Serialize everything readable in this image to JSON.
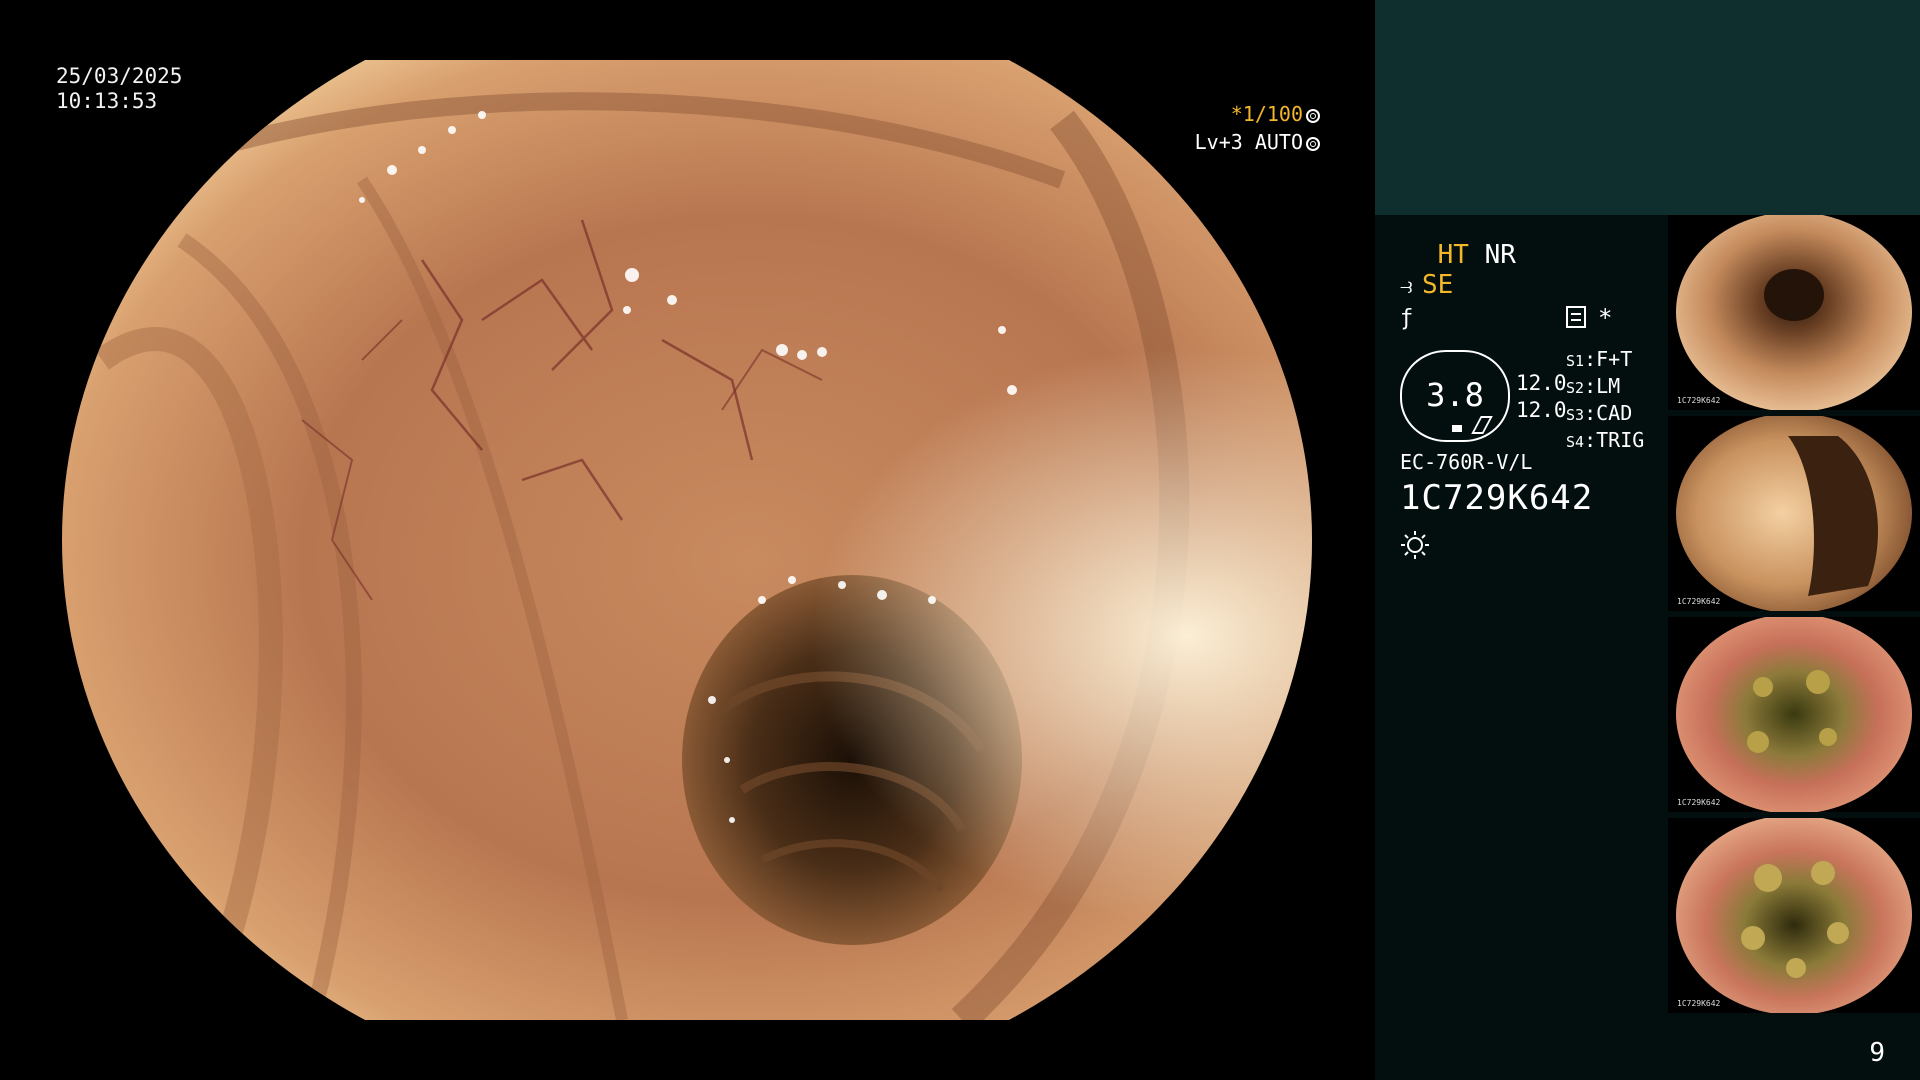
{
  "overlay": {
    "date": "25/03/2025",
    "time": "10:13:53",
    "shutter": "*1/100",
    "level_auto": "Lv+3 AUTO"
  },
  "status": {
    "mode_ht": "HT",
    "mode_nr": "NR",
    "mode_se": "SE",
    "lens_value": "3.8",
    "value_a": "12.0",
    "value_b": "12.0",
    "asterisk": "*",
    "switches": [
      {
        "key": "S1",
        "value": "F+T"
      },
      {
        "key": "S2",
        "value": "LM"
      },
      {
        "key": "S3",
        "value": "CAD"
      },
      {
        "key": "S4",
        "value": "TRIG"
      }
    ],
    "scope_model": "EC-760R-V/L",
    "serial": "1C729K642",
    "page_number": "9"
  },
  "thumbnails": [
    {
      "label": "1C729K642",
      "scene": "lumen-folds"
    },
    {
      "label": "1C729K642",
      "scene": "lumen-side"
    },
    {
      "label": "1C729K642",
      "scene": "debris-lumen"
    },
    {
      "label": "1C729K642",
      "scene": "debris-lumen"
    }
  ],
  "colors": {
    "panel_top": "#0f2e2e",
    "panel_side": "#030f0f",
    "accent_orange": "#f3b82a",
    "mucosa": "#b97a55"
  },
  "icons": {
    "light": "sun-icon",
    "mode": "scope-mode-icon",
    "shutter": "aperture-icon"
  }
}
